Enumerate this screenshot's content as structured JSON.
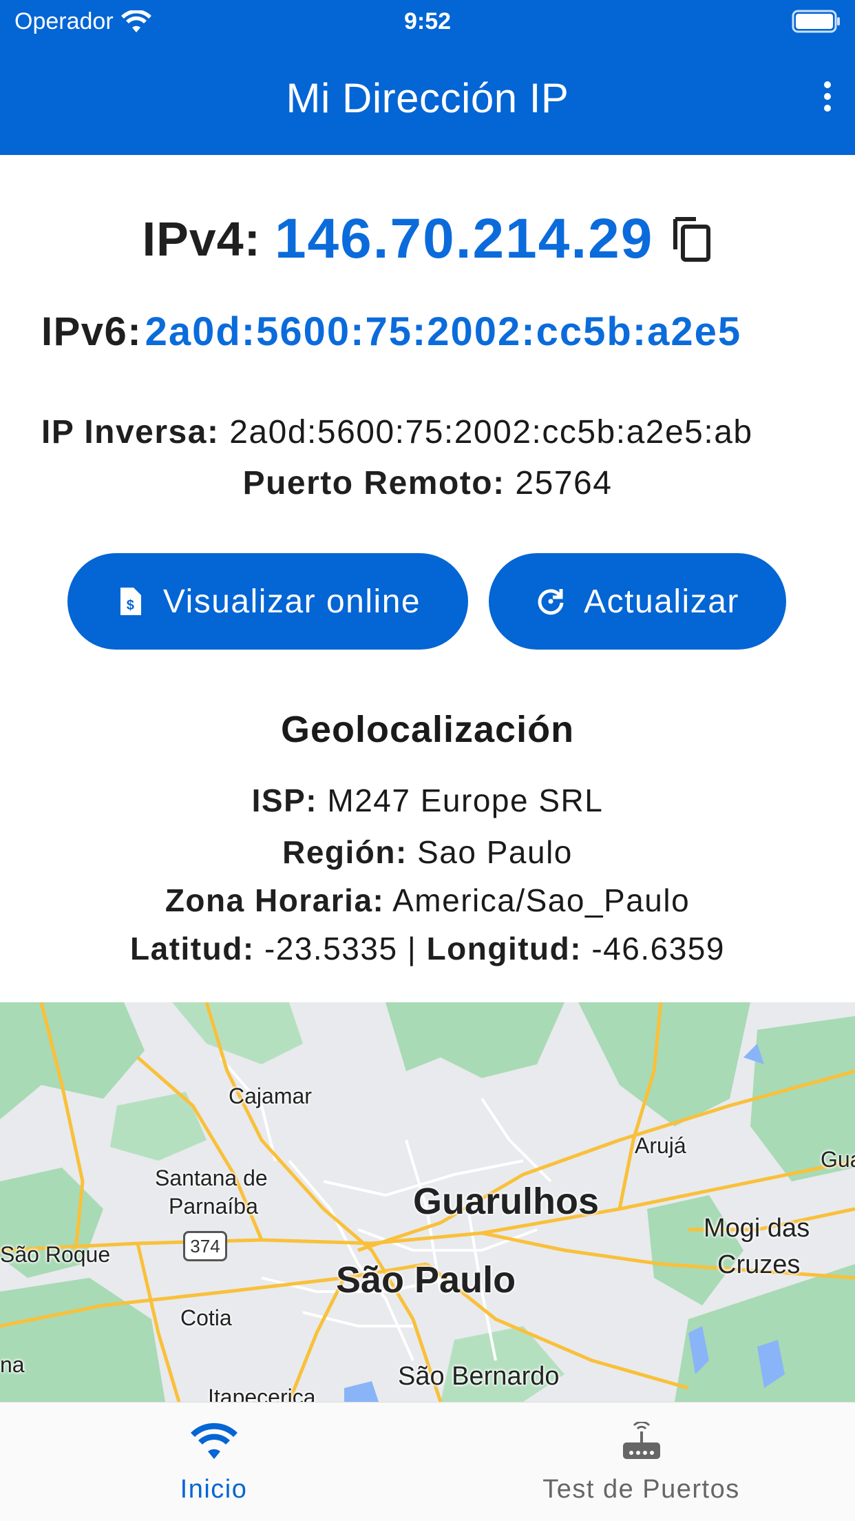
{
  "status_bar": {
    "carrier": "Operador",
    "time": "9:52"
  },
  "app_bar": {
    "title": "Mi Dirección IP",
    "menu_icon": "more-vert-icon"
  },
  "ip": {
    "ipv4_label": "IPv4:",
    "ipv4_value": "146.70.214.29",
    "ipv6_label": "IPv6:",
    "ipv6_value": "2a0d:5600:75:2002:cc5b:a2e5",
    "reverse_label": "IP Inversa:",
    "reverse_value": "2a0d:5600:75:2002:cc5b:a2e5:ab",
    "port_label": "Puerto Remoto:",
    "port_value": "25764"
  },
  "actions": {
    "view_online": "Visualizar online",
    "refresh": "Actualizar"
  },
  "geo": {
    "title": "Geolocalización",
    "isp_label": "ISP:",
    "isp_value": "M247 Europe SRL",
    "region_label": "Región:",
    "region_value": "Sao Paulo",
    "tz_label": "Zona Horaria:",
    "tz_value": "America/Sao_Paulo",
    "lat_label": "Latitud:",
    "lat_value": "-23.5335",
    "separator": "|",
    "lon_label": "Longitud:",
    "lon_value": "-46.6359"
  },
  "map": {
    "labels": {
      "cajamar": "Cajamar",
      "aruja": "Arujá",
      "gua": "Gua",
      "santana1": "Santana de",
      "santana2": "Parnaíba",
      "guarulhos": "Guarulhos",
      "mogi1": "Mogi das",
      "mogi2": "Cruzes",
      "sao_roque": "São Roque",
      "sao_paulo": "São Paulo",
      "cotia": "Cotia",
      "na": "na",
      "sao_bernardo": "São Bernardo",
      "itapecerica": "Itapecerica",
      "route": "374"
    },
    "colors": {
      "land": "#e8eaed",
      "green": "#a8dab5",
      "highway": "#f9c03a",
      "road": "#ffffff",
      "water": "#8ab4f8"
    }
  },
  "bottom_nav": {
    "home": "Inicio",
    "ports": "Test de Puertos"
  },
  "colors": {
    "primary": "#0465d4",
    "ip_value": "#0b6bdb"
  }
}
